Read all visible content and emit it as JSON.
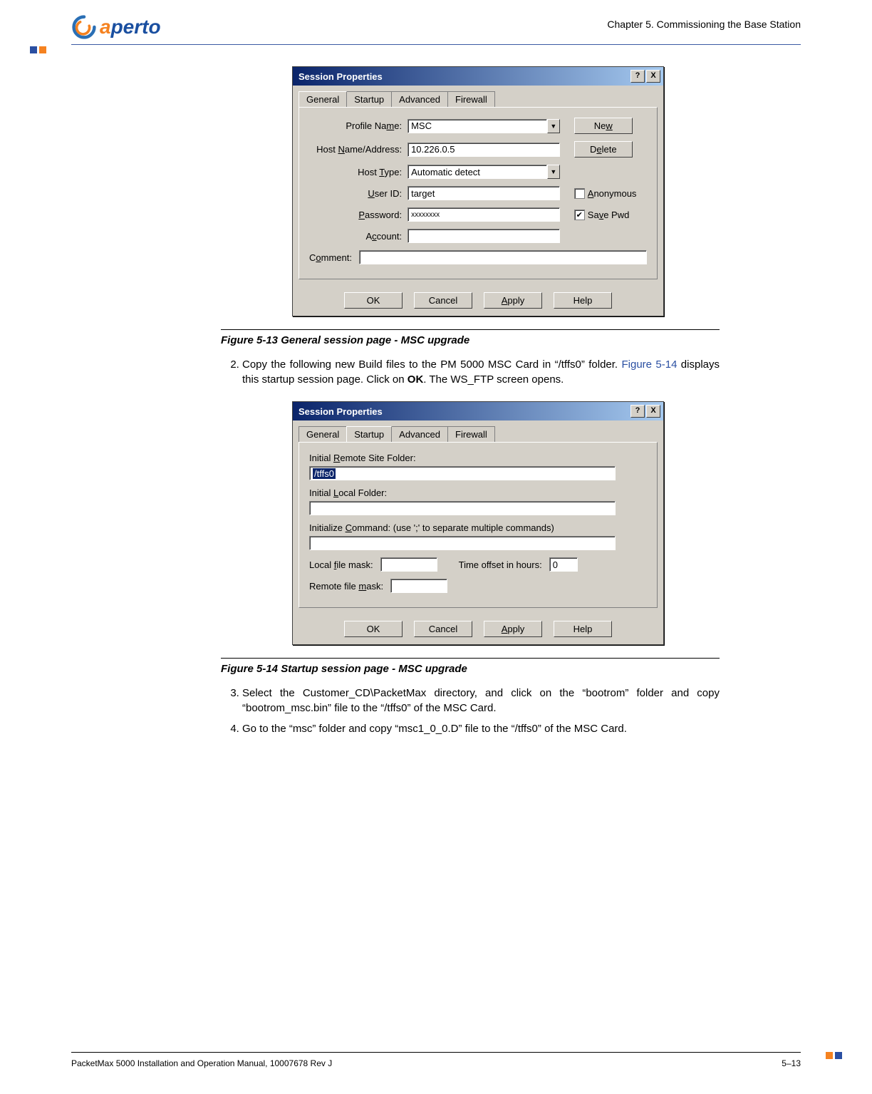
{
  "header": {
    "logo_text": "aperto",
    "chapter": "Chapter 5.  Commissioning the Base Station"
  },
  "dialog1": {
    "title": "Session Properties",
    "tabs": [
      "General",
      "Startup",
      "Advanced",
      "Firewall"
    ],
    "labels": {
      "profile": "Profile Name:",
      "host": "Host Name/Address:",
      "hosttype": "Host Type:",
      "userid": "User ID:",
      "password": "Password:",
      "account": "Account:",
      "comment": "Comment:"
    },
    "values": {
      "profile": "MSC",
      "host": "10.226.0.5",
      "hosttype": "Automatic detect",
      "userid": "target",
      "password": "xxxxxxxx",
      "account": "",
      "comment": ""
    },
    "buttons": {
      "new": "New",
      "delete": "Delete",
      "anonymous": "Anonymous",
      "savepwd": "Save Pwd",
      "ok": "OK",
      "cancel": "Cancel",
      "apply": "Apply",
      "help": "Help"
    }
  },
  "figure13": {
    "caption": "Figure 5-13      General session page - MSC upgrade"
  },
  "step2": {
    "num": "2.",
    "text_a": "Copy the following new Build files to the PM 5000 MSC Card in “/tffs0” folder. ",
    "link": "Figure 5-14",
    "text_b": " displays this startup session page. Click on ",
    "bold": "OK",
    "text_c": ". The WS_FTP screen opens."
  },
  "dialog2": {
    "title": "Session Properties",
    "tabs": [
      "General",
      "Startup",
      "Advanced",
      "Firewall"
    ],
    "labels": {
      "remote": "Initial Remote Site Folder:",
      "local": "Initial Local Folder:",
      "init": "Initialize Command: (use ';' to separate multiple commands)",
      "localmask": "Local file mask:",
      "timeoffset": "Time offset in hours:",
      "remotemask": "Remote file mask:"
    },
    "values": {
      "remote": "/tffs0",
      "local": "",
      "init": "",
      "localmask": "",
      "timeoffset": "0",
      "remotemask": ""
    },
    "buttons": {
      "ok": "OK",
      "cancel": "Cancel",
      "apply": "Apply",
      "help": "Help"
    }
  },
  "figure14": {
    "caption": "Figure 5-14      Startup session page - MSC upgrade"
  },
  "step3": {
    "num": "3.",
    "text": "Select the Customer_CD\\PacketMax directory, and click on the “bootrom” folder and copy “bootrom_msc.bin” file to the “/tffs0” of the MSC Card."
  },
  "step4": {
    "num": "4.",
    "text": "Go to the “msc” folder and copy “msc1_0_0.D” file to the “/tffs0” of the MSC Card."
  },
  "footer": {
    "left": "PacketMax 5000 Installation and Operation Manual,   10007678 Rev J",
    "right": "5–13"
  }
}
